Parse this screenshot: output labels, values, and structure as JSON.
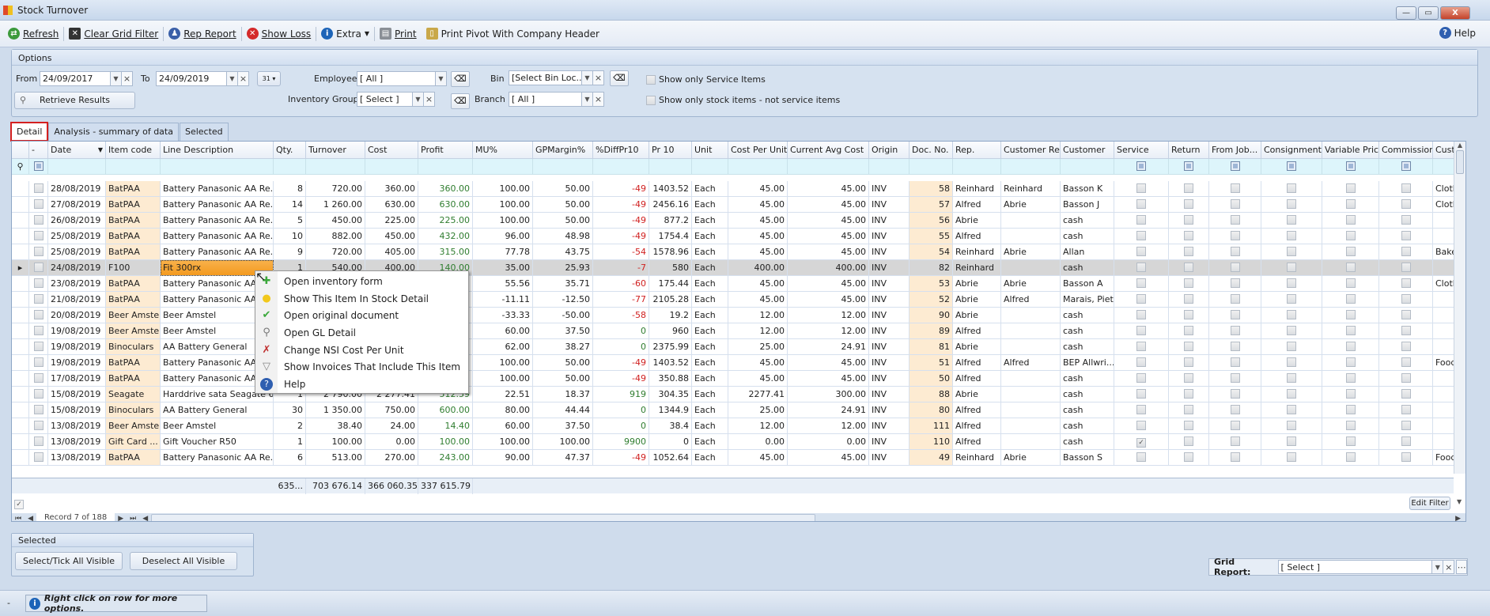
{
  "window": {
    "title": "Stock Turnover",
    "minimize": "—",
    "maximize": "▭",
    "close": "X"
  },
  "toolbar": {
    "refresh": "Refresh",
    "clear_grid_filter": "Clear Grid Filter",
    "rep_report": "Rep Report",
    "show_loss": "Show Loss",
    "extra": "Extra",
    "print": "Print",
    "print_pivot": "Print Pivot With Company Header",
    "help": "Help"
  },
  "options": {
    "title": "Options",
    "from_label": "From",
    "from_value": "24/09/2017",
    "to_label": "To",
    "to_value": "24/09/2019",
    "calendar": "31",
    "retrieve": "Retrieve Results",
    "employee_label": "Employee",
    "employee_value": "[ All ]",
    "inventory_group_label": "Inventory Group",
    "inventory_group_value": "[ Select ]",
    "bin_label": "Bin",
    "bin_value": "[Select Bin Loc...",
    "branch_label": "Branch",
    "branch_value": "[ All ]",
    "service_only": "Show only Service Items",
    "stock_only": "Show only stock items - not service items"
  },
  "tabs": [
    {
      "label": "Detail",
      "active": true
    },
    {
      "label": "Analysis - summary of data"
    },
    {
      "label": "Selected"
    }
  ],
  "grid": {
    "columns": [
      "",
      "-",
      "Date",
      "Item code",
      "Line Description",
      "Qty.",
      "Turnover",
      "Cost",
      "Profit",
      "MU%",
      "GPMargin%",
      "%DiffPr10",
      "Pr 10",
      "Unit",
      "Cost Per Unit",
      "Current Avg Cost",
      "Origin",
      "Doc. No.",
      "Rep.",
      "Customer Rep",
      "Customer",
      "Service",
      "Return",
      "From Job...",
      "Consignment",
      "Variable Price",
      "Commission",
      "Cust"
    ],
    "sort_column": "Date",
    "selected_row": 5,
    "rows": [
      [
        "28/08/2019",
        "BatPAA",
        "Battery Panasonic AA Re...",
        "8",
        "720.00",
        "360.00",
        "360.00",
        "100.00",
        "50.00",
        "-49",
        "1403.52",
        "Each",
        "45.00",
        "45.00",
        "INV",
        "58",
        "Reinhard",
        "Reinhard",
        "Basson K",
        false,
        "Cloth"
      ],
      [
        "27/08/2019",
        "BatPAA",
        "Battery Panasonic AA Re...",
        "14",
        "1 260.00",
        "630.00",
        "630.00",
        "100.00",
        "50.00",
        "-49",
        "2456.16",
        "Each",
        "45.00",
        "45.00",
        "INV",
        "57",
        "Alfred",
        "Abrie",
        "Basson J",
        false,
        "Cloth"
      ],
      [
        "26/08/2019",
        "BatPAA",
        "Battery Panasonic AA Re...",
        "5",
        "450.00",
        "225.00",
        "225.00",
        "100.00",
        "50.00",
        "-49",
        "877.2",
        "Each",
        "45.00",
        "45.00",
        "INV",
        "56",
        "Abrie",
        "",
        "cash",
        false,
        ""
      ],
      [
        "25/08/2019",
        "BatPAA",
        "Battery Panasonic AA Re...",
        "10",
        "882.00",
        "450.00",
        "432.00",
        "96.00",
        "48.98",
        "-49",
        "1754.4",
        "Each",
        "45.00",
        "45.00",
        "INV",
        "55",
        "Alfred",
        "",
        "cash",
        false,
        ""
      ],
      [
        "25/08/2019",
        "BatPAA",
        "Battery Panasonic AA Re...",
        "9",
        "720.00",
        "405.00",
        "315.00",
        "77.78",
        "43.75",
        "-54",
        "1578.96",
        "Each",
        "45.00",
        "45.00",
        "INV",
        "54",
        "Reinhard",
        "Abrie",
        "Allan",
        false,
        "Bake"
      ],
      [
        "24/08/2019",
        "F100",
        "Fit 300rx",
        "1",
        "540.00",
        "400.00",
        "140.00",
        "35.00",
        "25.93",
        "-7",
        "580",
        "Each",
        "400.00",
        "400.00",
        "INV",
        "82",
        "Reinhard",
        "",
        "cash",
        false,
        ""
      ],
      [
        "23/08/2019",
        "BatPAA",
        "Battery Panasonic AA Re...",
        "",
        "",
        "",
        "",
        "55.56",
        "35.71",
        "-60",
        "175.44",
        "Each",
        "45.00",
        "45.00",
        "INV",
        "53",
        "Abrie",
        "Abrie",
        "Basson A",
        false,
        "Cloth"
      ],
      [
        "21/08/2019",
        "BatPAA",
        "Battery Panasonic AA Re...",
        "",
        "",
        "",
        "",
        "-11.11",
        "-12.50",
        "-77",
        "2105.28",
        "Each",
        "45.00",
        "45.00",
        "INV",
        "52",
        "Abrie",
        "Alfred",
        "Marais, Piet",
        false,
        ""
      ],
      [
        "20/08/2019",
        "Beer Amstel",
        "Beer Amstel",
        "",
        "",
        "",
        "",
        "-33.33",
        "-50.00",
        "-58",
        "19.2",
        "Each",
        "12.00",
        "12.00",
        "INV",
        "90",
        "Abrie",
        "",
        "cash",
        false,
        ""
      ],
      [
        "19/08/2019",
        "Beer Amstel",
        "Beer Amstel",
        "",
        "",
        "",
        "",
        "60.00",
        "37.50",
        "0",
        "960",
        "Each",
        "12.00",
        "12.00",
        "INV",
        "89",
        "Alfred",
        "",
        "cash",
        false,
        ""
      ],
      [
        "19/08/2019",
        "Binoculars",
        "AA Battery General",
        "",
        "",
        "",
        "",
        "62.00",
        "38.27",
        "0",
        "2375.99",
        "Each",
        "25.00",
        "24.91",
        "INV",
        "81",
        "Abrie",
        "",
        "cash",
        false,
        ""
      ],
      [
        "19/08/2019",
        "BatPAA",
        "Battery Panasonic AA Re...",
        "",
        "",
        "",
        "",
        "100.00",
        "50.00",
        "-49",
        "1403.52",
        "Each",
        "45.00",
        "45.00",
        "INV",
        "51",
        "Alfred",
        "Alfred",
        "BEP Allwri...",
        false,
        "Food"
      ],
      [
        "17/08/2019",
        "BatPAA",
        "Battery Panasonic AA Re...",
        "",
        "",
        "",
        "",
        "100.00",
        "50.00",
        "-49",
        "350.88",
        "Each",
        "45.00",
        "45.00",
        "INV",
        "50",
        "Alfred",
        "",
        "cash",
        false,
        ""
      ],
      [
        "15/08/2019",
        "Seagate",
        "Harddrive sata Seagate 6...",
        "1",
        "2 790.00",
        "2 277.41",
        "512.59",
        "22.51",
        "18.37",
        "919",
        "304.35",
        "Each",
        "2277.41",
        "300.00",
        "INV",
        "88",
        "Abrie",
        "",
        "cash",
        false,
        ""
      ],
      [
        "15/08/2019",
        "Binoculars",
        "AA Battery General",
        "30",
        "1 350.00",
        "750.00",
        "600.00",
        "80.00",
        "44.44",
        "0",
        "1344.9",
        "Each",
        "25.00",
        "24.91",
        "INV",
        "80",
        "Alfred",
        "",
        "cash",
        false,
        ""
      ],
      [
        "13/08/2019",
        "Beer Amstel",
        "Beer Amstel",
        "2",
        "38.40",
        "24.00",
        "14.40",
        "60.00",
        "37.50",
        "0",
        "38.4",
        "Each",
        "12.00",
        "12.00",
        "INV",
        "111",
        "Alfred",
        "",
        "cash",
        false,
        ""
      ],
      [
        "13/08/2019",
        "Gift Card ...",
        "Gift Voucher R50",
        "1",
        "100.00",
        "0.00",
        "100.00",
        "100.00",
        "100.00",
        "9900",
        "0",
        "Each",
        "0.00",
        "0.00",
        "INV",
        "110",
        "Alfred",
        "",
        "cash",
        true,
        ""
      ],
      [
        "13/08/2019",
        "BatPAA",
        "Battery Panasonic AA Re...",
        "6",
        "513.00",
        "270.00",
        "243.00",
        "90.00",
        "47.37",
        "-49",
        "1052.64",
        "Each",
        "45.00",
        "45.00",
        "INV",
        "49",
        "Reinhard",
        "Abrie",
        "Basson S",
        false,
        "Food"
      ]
    ],
    "summary": {
      "qty": "635...",
      "turnover": "703 676.14",
      "cost": "366 060.35",
      "profit": "337 615.79"
    },
    "edit_filter": "Edit Filter",
    "navigator": "Record 7 of 188"
  },
  "context_menu": [
    {
      "label": "Open inventory form",
      "icon": "plus-icon"
    },
    {
      "label": "Show This Item In Stock Detail",
      "icon": "yellow-circle-icon"
    },
    {
      "label": "Open original document",
      "icon": "check-icon"
    },
    {
      "label": "Open GL Detail",
      "icon": "magnifier-icon"
    },
    {
      "label": "Change NSI Cost Per Unit",
      "icon": "tools-icon"
    },
    {
      "label": "Show Invoices That Include This Item",
      "icon": "filter-icon"
    },
    {
      "label": "Help",
      "icon": "help-icon"
    }
  ],
  "selected_group": {
    "title": "Selected",
    "select_all": "Select/Tick All Visible",
    "deselect_all": "Deselect All Visible"
  },
  "grid_report": {
    "label": "Grid Report:",
    "value": "[ Select ]"
  },
  "status": {
    "dash": "-",
    "hint": "Right click on row for more options."
  },
  "colors": {
    "accent": "#f39a1f",
    "positive": "#2f7d2f",
    "negative": "#d02020",
    "code_bg": "#fdebd2"
  }
}
